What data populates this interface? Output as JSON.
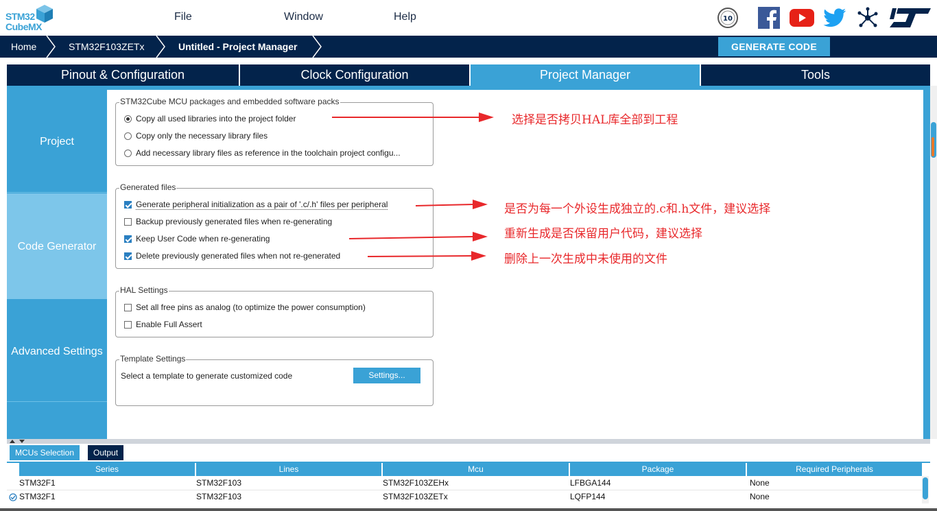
{
  "app": {
    "logo_line1": "STM32",
    "logo_line2": "CubeMX"
  },
  "menu": {
    "file": "File",
    "window": "Window",
    "help": "Help"
  },
  "social": [
    "anniversary-badge-icon",
    "facebook-icon",
    "youtube-icon",
    "twitter-icon",
    "network-icon",
    "st-logo-icon"
  ],
  "breadcrumb": {
    "home": "Home",
    "mcu": "STM32F103ZETx",
    "project": "Untitled - Project Manager"
  },
  "generate_button": "GENERATE CODE",
  "tabs": [
    {
      "label": "Pinout & Configuration"
    },
    {
      "label": "Clock Configuration"
    },
    {
      "label": "Project Manager"
    },
    {
      "label": "Tools"
    }
  ],
  "active_tab": "Project Manager",
  "side": {
    "project": "Project",
    "code_generator": "Code Generator",
    "advanced": "Advanced Settings"
  },
  "packages": {
    "title": "STM32Cube MCU packages and embedded software packs",
    "opt1": "Copy all used libraries into the project folder",
    "opt2": "Copy only the necessary library files",
    "opt3": "Add necessary library files as reference in the toolchain project configu...",
    "selected": "opt1"
  },
  "generated": {
    "title": "Generated files",
    "opt1": "Generate peripheral initialization as a pair of '.c/.h' files per peripheral",
    "opt2": "Backup previously generated files when re-generating",
    "opt3": "Keep User Code when re-generating",
    "opt4": "Delete previously generated files when not re-generated",
    "checked": [
      true,
      false,
      true,
      true
    ]
  },
  "hal": {
    "title": "HAL Settings",
    "opt1": "Set all free pins as analog (to optimize the power consumption)",
    "opt2": "Enable Full Assert",
    "checked": [
      false,
      false
    ]
  },
  "template": {
    "title": "Template Settings",
    "text": "Select a template to generate customized code",
    "button": "Settings..."
  },
  "annotations": {
    "a1": "选择是否拷贝HAL库全部到工程",
    "a2": "是否为每一个外设生成独立的.c和.h文件，建议选择",
    "a3": "重新生成是否保留用户代码，建议选择",
    "a4": "删除上一次生成中未使用的文件"
  },
  "colors": {
    "navy": "#03234b",
    "accent": "#3aa2d6",
    "annotation": "#e8282b"
  },
  "bottom": {
    "tab1": "MCUs Selection",
    "tab2": "Output",
    "headers": [
      "Series",
      "Lines",
      "Mcu",
      "Package",
      "Required Peripherals"
    ],
    "rows": [
      {
        "series": "STM32F1",
        "lines": "STM32F103",
        "mcu": "STM32F103ZEHx",
        "package": "LFBGA144",
        "req": "None",
        "selected": false
      },
      {
        "series": "STM32F1",
        "lines": "STM32F103",
        "mcu": "STM32F103ZETx",
        "package": "LQFP144",
        "req": "None",
        "selected": true
      }
    ]
  }
}
